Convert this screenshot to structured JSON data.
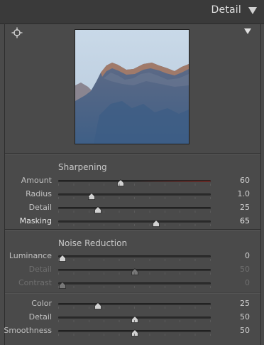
{
  "panel": {
    "title": "Detail",
    "collapse_icon": "triangle-down-icon",
    "target_icon": "crosshair-icon",
    "preview_menu_icon": "triangle-down-icon"
  },
  "sharpening": {
    "title": "Sharpening",
    "sliders": [
      {
        "label": "Amount",
        "value": "60",
        "fraction": 0.41,
        "red_track": true
      },
      {
        "label": "Radius",
        "value": "1.0",
        "fraction": 0.22
      },
      {
        "label": "Detail",
        "value": "25",
        "fraction": 0.26
      },
      {
        "label": "Masking",
        "value": "65",
        "fraction": 0.64,
        "bright": true
      }
    ]
  },
  "noise_reduction": {
    "title": "Noise Reduction",
    "sliders": [
      {
        "label": "Luminance",
        "value": "0",
        "fraction": 0.03
      },
      {
        "label": "Detail",
        "value": "50",
        "fraction": 0.5,
        "disabled": true
      },
      {
        "label": "Contrast",
        "value": "0",
        "fraction": 0.03,
        "disabled": true
      },
      {
        "label": "Color",
        "value": "25",
        "fraction": 0.26
      },
      {
        "label": "Detail",
        "value": "50",
        "fraction": 0.5
      },
      {
        "label": "Smoothness",
        "value": "50",
        "fraction": 0.5
      }
    ]
  },
  "colors": {
    "panel_bg": "#4a4a4a",
    "header_bg": "#3a3a3a",
    "amount_track_accent": "#6e2a26"
  }
}
